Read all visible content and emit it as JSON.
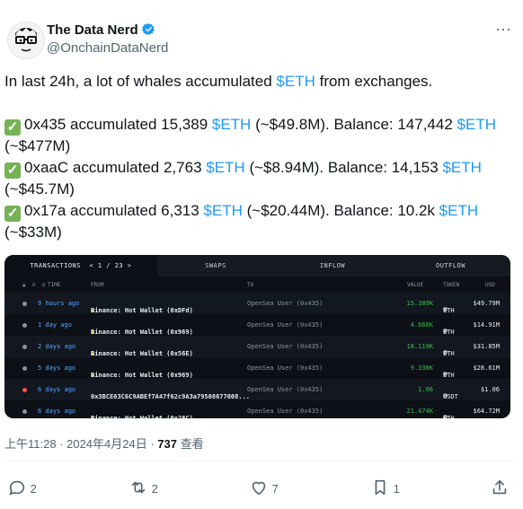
{
  "author": {
    "name": "The Data Nerd",
    "handle": "@OnchainDataNerd",
    "verified_color": "#1d9bf0"
  },
  "tweet": {
    "intro_prefix": "In last 24h, a lot of whales accumulated ",
    "intro_tag": "$ETH",
    "intro_suffix": " from exchanges.",
    "lines": [
      {
        "a": "0x435 accumulated 15,389 ",
        "tag1": "$ETH",
        "b": " (~$49.8M). Balance: 147,442 ",
        "tag2": "$ETH",
        "c": "(~$477M)"
      },
      {
        "a": "0xaaC accumulated 2,763 ",
        "tag1": "$ETH",
        "b": " (~$8.94M). Balance: 14,153 ",
        "tag2": "$ETH",
        "c": "(~$45.7M)"
      },
      {
        "a": "0x17a accumulated 6,313 ",
        "tag1": "$ETH",
        "b": " (~$20.44M). Balance: 10.2k ",
        "tag2": "$ETH",
        "c": "(~$33M)"
      }
    ],
    "check_glyph": "✓"
  },
  "image": {
    "tabs": [
      "TRANSACTIONS",
      "SWAPS",
      "INFLOW",
      "OUTFLOW"
    ],
    "pager": "< 1 / 23 >",
    "headers": {
      "time": "TIME",
      "from": "FROM",
      "to": "TO",
      "value": "VALUE",
      "token": "TOKEN",
      "usd": "USD"
    },
    "rows": [
      {
        "time": "9 hours ago",
        "from": "Binance: Hot Wallet (0xDFd)",
        "to": "OpenSea User (0x435)",
        "value": "15.389K",
        "token": "ETH",
        "usd": "$49.79M",
        "dot": "#8b949e"
      },
      {
        "time": "1 day ago",
        "from": "Binance: Hot Wallet (0x969)",
        "to": "OpenSea User (0x435)",
        "value": "4.666K",
        "token": "ETH",
        "usd": "$14.91M",
        "dot": "#8b949e"
      },
      {
        "time": "2 days ago",
        "from": "Binance: Hot Wallet (0x56E)",
        "to": "OpenSea User (0x435)",
        "value": "18.119K",
        "token": "ETH",
        "usd": "$31.85M",
        "dot": "#8b949e"
      },
      {
        "time": "5 days ago",
        "from": "Binance: Hot Wallet (0x969)",
        "to": "OpenSea User (0x435)",
        "value": "9.330K",
        "token": "ETH",
        "usd": "$28.61M",
        "dot": "#8b949e"
      },
      {
        "time": "6 days ago",
        "from": "0x3BCE63C6C9ABEf7A47f62c9A3a79508677008...",
        "to": "OpenSea User (0x435)",
        "value": "1.06",
        "token": "USDT",
        "usd": "$1.06",
        "dot": "#f85149"
      },
      {
        "time": "6 days ago",
        "from": "Binance: Hot Wallet (0x28C)",
        "to": "OpenSea User (0x435)",
        "value": "21.474K",
        "token": "ETH",
        "usd": "$64.72M",
        "dot": "#8b949e"
      }
    ]
  },
  "meta": {
    "timestamp": "上午11:28 · 2024年4月24日 · ",
    "views_count": "737",
    "views_label": " 查看"
  },
  "actions": {
    "replies": "2",
    "retweets": "2",
    "likes": "7",
    "bookmarks": "1"
  }
}
